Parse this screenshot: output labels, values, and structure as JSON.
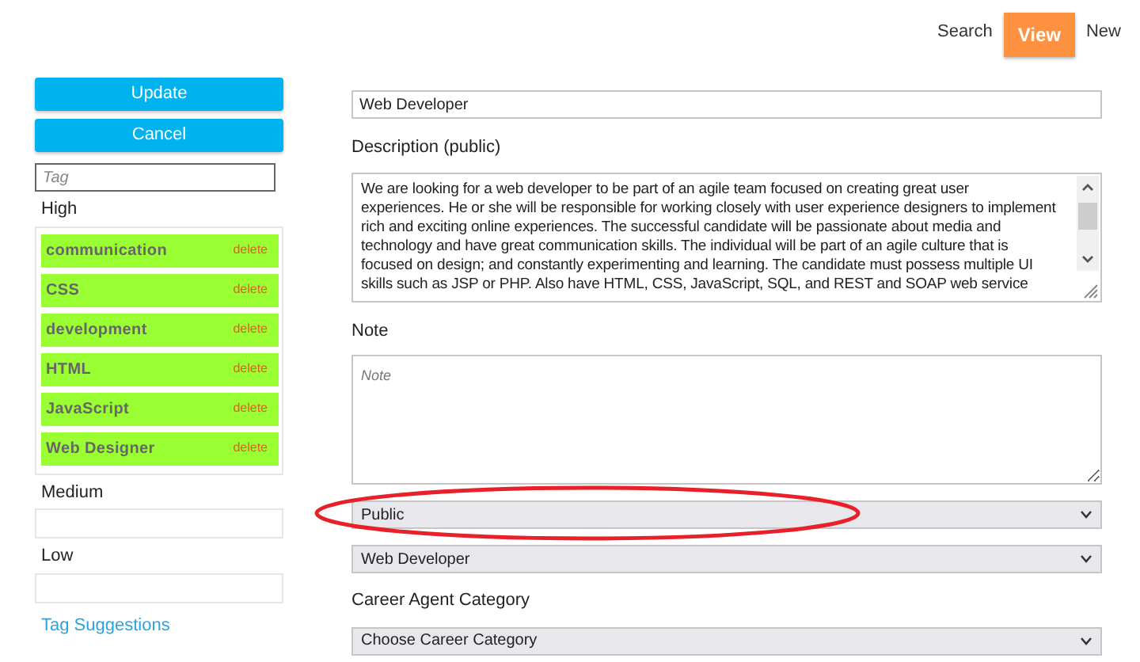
{
  "nav": [
    {
      "label": "Search",
      "selected": false
    },
    {
      "label": "View",
      "selected": true
    },
    {
      "label": "New",
      "selected": false
    }
  ],
  "buttons": [
    "Update",
    "Cancel"
  ],
  "tag_field": {
    "placeholder": "Tag"
  },
  "tag_groups": [
    {
      "label": "High",
      "tags": [
        {
          "name": "communication",
          "action": "delete"
        },
        {
          "name": "CSS",
          "action": "delete"
        },
        {
          "name": "development",
          "action": "delete"
        },
        {
          "name": "HTML",
          "action": "delete"
        },
        {
          "name": "JavaScript",
          "action": "delete"
        },
        {
          "name": "Web Designer",
          "action": "delete"
        }
      ]
    },
    {
      "label": "Medium"
    },
    {
      "label": "Low"
    }
  ],
  "tag_suggestions_link": "Tag Suggestions",
  "title_field": {
    "value": "Web Developer"
  },
  "description": {
    "label": "Description (public)",
    "lines": [
      "We are looking for a web developer to be part of an agile team focused on creating great user",
      "experiences. He or she will be responsible for working closely with user experience designers to implement",
      "rich and exciting online experiences. The successful candidate will be passionate about media and",
      "technology and have great communication skills. The individual will be part of an agile culture that is",
      "focused on design; and constantly experimenting and learning. The candidate must possess multiple UI",
      "skills such as JSP or PHP. Also have HTML, CSS, JavaScript, SQL, and REST and SOAP web service"
    ]
  },
  "note": {
    "label": "Note",
    "placeholder": "Note"
  },
  "selects": [
    {
      "kind": "select",
      "value": "Public",
      "circled": true
    },
    {
      "kind": "select",
      "value": "Web Developer",
      "circled": false
    },
    {
      "kind": "label",
      "value": "Career Agent Category"
    },
    {
      "kind": "select",
      "value": "Choose Career Category",
      "circled": false
    }
  ]
}
